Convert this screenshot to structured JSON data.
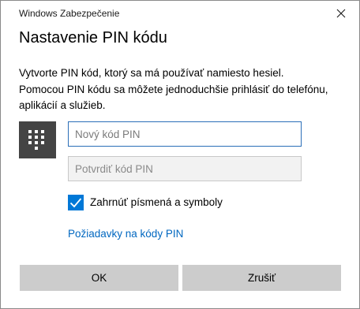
{
  "window": {
    "title": "Windows Zabezpečenie",
    "close_icon": "close-icon"
  },
  "heading": "Nastavenie PIN kódu",
  "description": {
    "line1": "Vytvorte PIN kód, ktorý sa má používať namiesto hesiel.",
    "line2": "Pomocou PIN kódu sa môžete jednoduchšie prihlásiť do telefónu,",
    "line3": "aplikácií a služieb."
  },
  "keypad_icon": "keypad-icon",
  "fields": {
    "new_pin": {
      "placeholder": "Nový kód PIN",
      "value": ""
    },
    "confirm_pin": {
      "placeholder": "Potvrdiť kód PIN",
      "value": ""
    }
  },
  "options": {
    "include_letters_label": "Zahrnúť písmená a symboly",
    "include_letters_checked": true
  },
  "link": {
    "pin_requirements": "Požiadavky na kódy PIN"
  },
  "buttons": {
    "ok": "OK",
    "cancel": "Zrušiť"
  },
  "colors": {
    "accent": "#0078d7",
    "link": "#0067c0",
    "keypad_tile": "#444444",
    "button_bg": "#cccccc"
  }
}
